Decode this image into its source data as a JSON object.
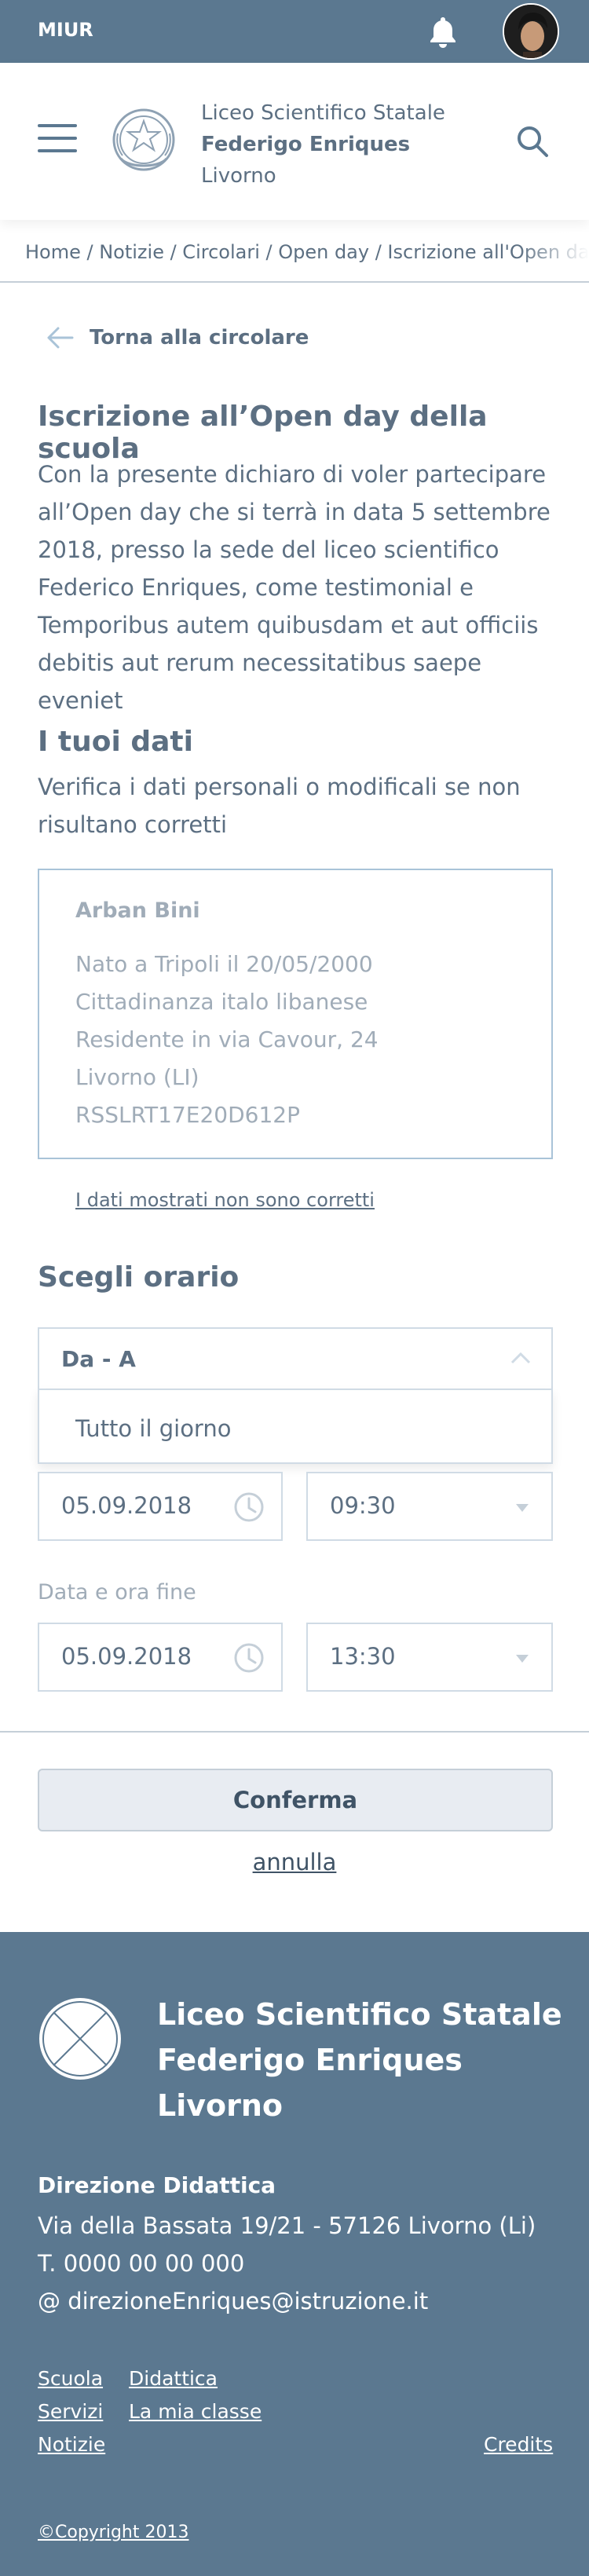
{
  "topbar": {
    "brand": "MIUR"
  },
  "header": {
    "school_line1": "Liceo Scientifico Statale",
    "school_line2": "Federigo Enriques",
    "school_line3": "Livorno"
  },
  "breadcrumb": {
    "text": "Home / Notizie / Circolari / Open day / Iscrizione all'Open day della scuola"
  },
  "back": {
    "label": "Torna alla circolare"
  },
  "page": {
    "title": "Iscrizione all’Open day della scuola",
    "intro": "Con la presente dichiaro di voler partecipare all’Open day che si terrà in data 5 settembre 2018, presso la sede del liceo scientifico Federico Enriques, come testimonial e Temporibus autem quibusdam et aut officiis debitis aut rerum necessitatibus saepe eveniet"
  },
  "dati": {
    "title": "I tuoi dati",
    "subtitle": "Verifica i dati personali o modificali se non risultano corretti",
    "card": {
      "name": "Arban Bini",
      "line1": "Nato a Tripoli il 20/05/2000",
      "line2": "Cittadinanza italo libanese",
      "line3": "Residente in via Cavour, 24",
      "line4": "Livorno (LI)",
      "line5": "RSSLRT17E20D612P"
    },
    "wrong_link": "I dati mostrati non sono corretti"
  },
  "orario": {
    "title": "Scegli orario",
    "select_value": "Da - A",
    "option_visible": "Tutto il giorno",
    "start_date": "05.09.2018",
    "start_time": "09:30",
    "end_label": "Data e ora fine",
    "end_date": "05.09.2018",
    "end_time": "13:30"
  },
  "actions": {
    "confirm": "Conferma",
    "cancel": "annulla"
  },
  "footer": {
    "name_line1": "Liceo Scientifico Statale",
    "name_line2": "Federigo Enriques",
    "name_line3": "Livorno",
    "dir_title": "Direzione Didattica",
    "address": "Via della Bassata 19/21 - 57126 Livorno (Li)",
    "phone": "T. 0000 00 00 000",
    "email": "@ direzioneEnriques@istruzione.it",
    "links": {
      "scuola": "Scuola",
      "didattica": "Didattica",
      "servizi": "Servizi",
      "classe": "La mia classe",
      "notizie": "Notizie",
      "credits": "Credits"
    },
    "copyright": "©Copyright 2013"
  },
  "colors": {
    "primary": "#5b7890",
    "text": "#5c6f82",
    "muted": "#a0acb8",
    "border": "#d0dbe5"
  },
  "icons": [
    "bell-icon",
    "avatar",
    "menu-icon",
    "emblem-icon",
    "search-icon",
    "arrow-left-icon",
    "chevron-up-icon",
    "clock-icon",
    "caret-down-icon",
    "placeholder-logo-icon"
  ]
}
